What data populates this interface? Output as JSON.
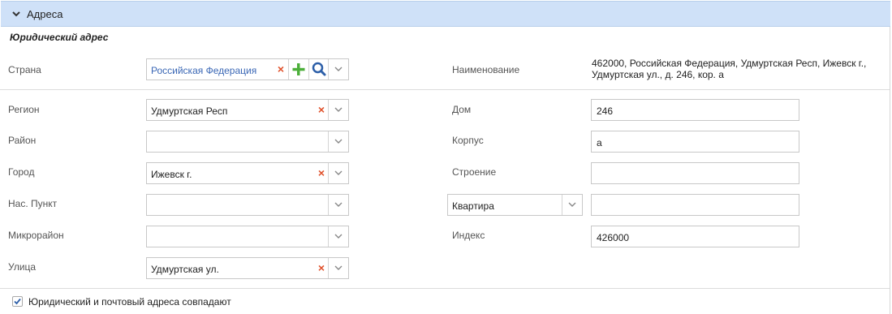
{
  "panel": {
    "title": "Адреса"
  },
  "section": {
    "title": "Юридический адрес"
  },
  "left": {
    "country": {
      "label": "Страна",
      "value": "Российская Федерация"
    },
    "region": {
      "label": "Регион",
      "value": "Удмуртская Респ"
    },
    "district": {
      "label": "Район",
      "value": ""
    },
    "city": {
      "label": "Город",
      "value": "Ижевск  г."
    },
    "settlement": {
      "label": "Нас. Пункт",
      "value": ""
    },
    "microdistrict": {
      "label": "Микрорайон",
      "value": ""
    },
    "street": {
      "label": "Улица",
      "value": "Удмуртская  ул."
    }
  },
  "right": {
    "name": {
      "label": "Наименование",
      "line1": "462000, Российская Федерация, Удмуртская Респ, Ижевск г.,",
      "line2": "Удмуртская ул., д. 246, кор. а"
    },
    "house": {
      "label": "Дом",
      "value": "246"
    },
    "building": {
      "label": "Корпус",
      "value": "а"
    },
    "structure": {
      "label": "Строение",
      "value": ""
    },
    "apt": {
      "type_value": "Квартира",
      "value": ""
    },
    "index": {
      "label": "Индекс",
      "value": "426000"
    }
  },
  "footer": {
    "same_address_label": "Юридический и почтовый адреса совпадают",
    "same_address_checked": true
  },
  "colors": {
    "header_bg": "#cfe1f8",
    "link_blue": "#3a67b5",
    "clear_red": "#e0502a",
    "add_green": "#4caf3a"
  }
}
